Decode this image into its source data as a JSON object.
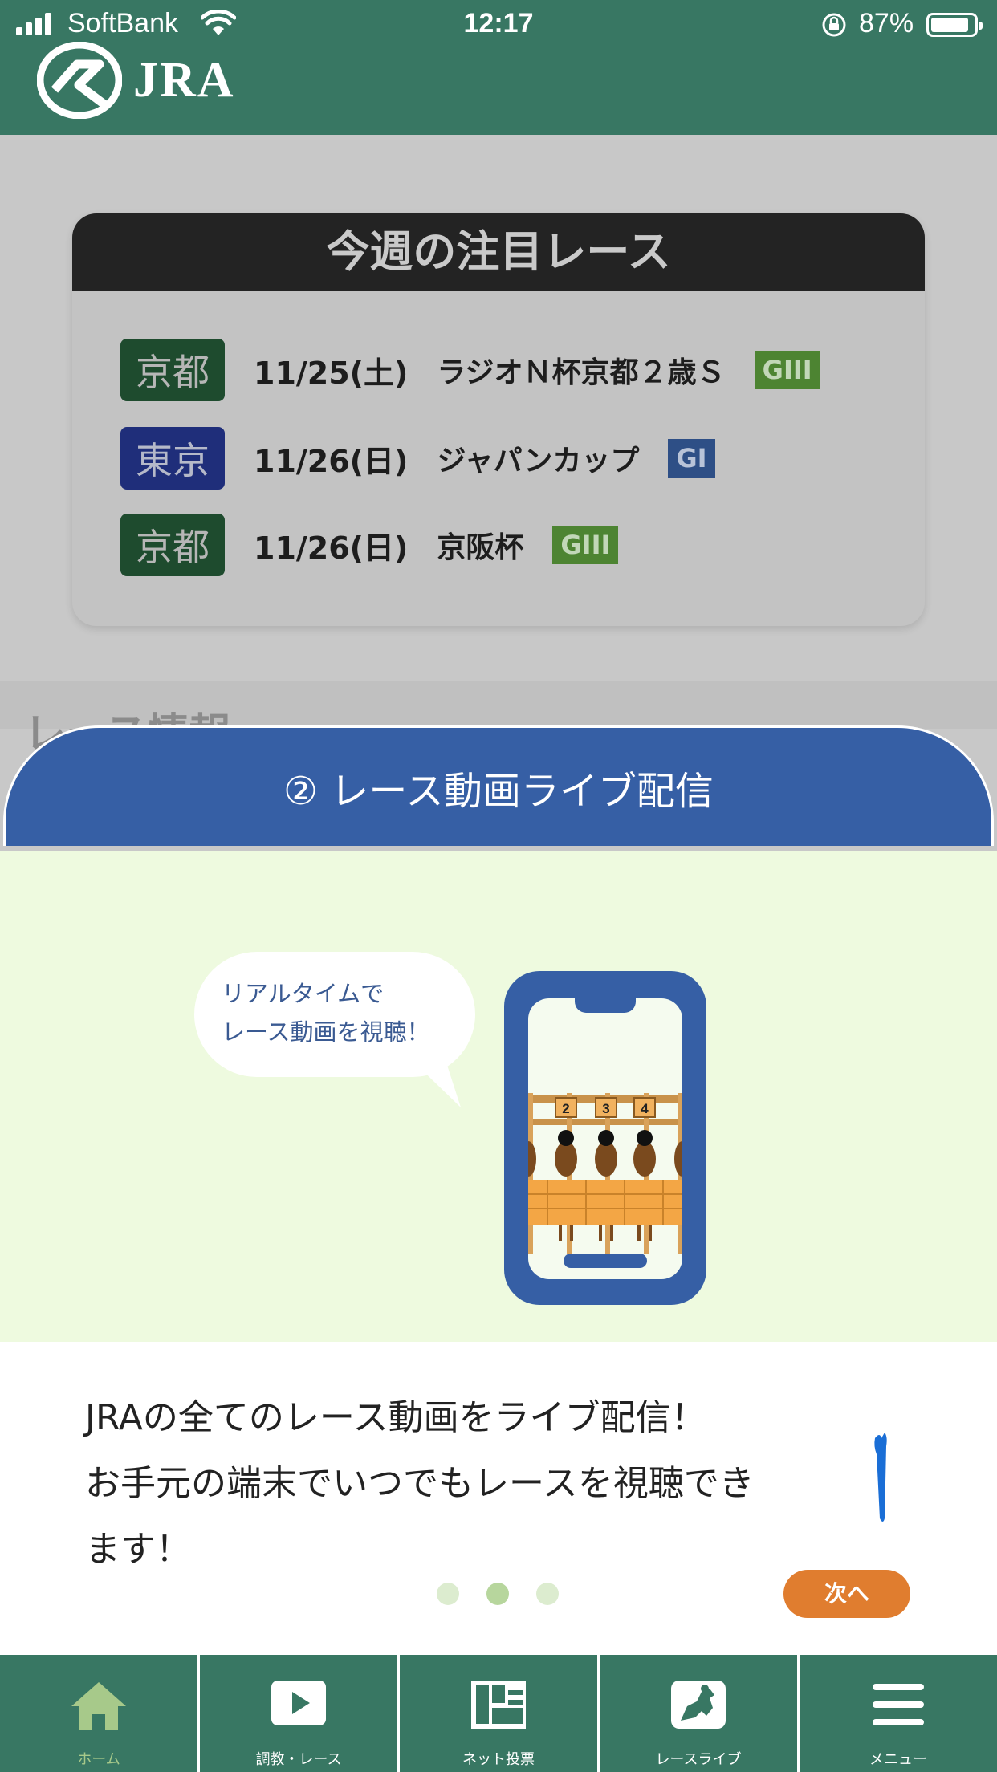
{
  "status_bar": {
    "carrier": "SoftBank",
    "time": "12:17",
    "battery": "87%"
  },
  "header": {
    "logo_text": "JRA"
  },
  "featured": {
    "title": "今週の注目レース",
    "races": [
      {
        "venue": "京都",
        "date": "11/25(土)",
        "name": "ラジオＮ杯京都２歳Ｓ",
        "grade": "GIII"
      },
      {
        "venue": "東京",
        "date": "11/26(日)",
        "name": "ジャパンカップ",
        "grade": "GI"
      },
      {
        "venue": "京都",
        "date": "11/26(日)",
        "name": "京阪杯",
        "grade": "GIII"
      }
    ]
  },
  "background_section": {
    "title_peek": "レース情報"
  },
  "modal": {
    "title": "② レース動画ライブ配信",
    "bubble": [
      "リアルタイムで",
      "レース動画を視聴！"
    ],
    "gates": [
      "2",
      "3",
      "4"
    ],
    "message": [
      "JRAの全てのレース動画をライブ配信！",
      "お手元の端末でいつでもレースを視聴でき",
      "ます！"
    ],
    "page_dots": {
      "count": 3,
      "current": 2
    },
    "next_label": "次へ"
  },
  "tabbar": {
    "tabs": [
      {
        "label": "ホーム",
        "icon": "home-icon",
        "active": true
      },
      {
        "label": "調教・レース",
        "icon": "play-icon",
        "active": false
      },
      {
        "label": "ネット投票",
        "icon": "voting-terminal-icon",
        "active": false
      },
      {
        "label": "レースライブ",
        "icon": "horse-live-icon",
        "active": false
      },
      {
        "label": "メニュー",
        "icon": "hamburger-menu-icon",
        "active": false
      }
    ]
  },
  "colors": {
    "header_green": "#387763",
    "modal_blue": "#365fa5",
    "next_orange": "#e07d2f",
    "illus_bg": "#eefadf"
  }
}
